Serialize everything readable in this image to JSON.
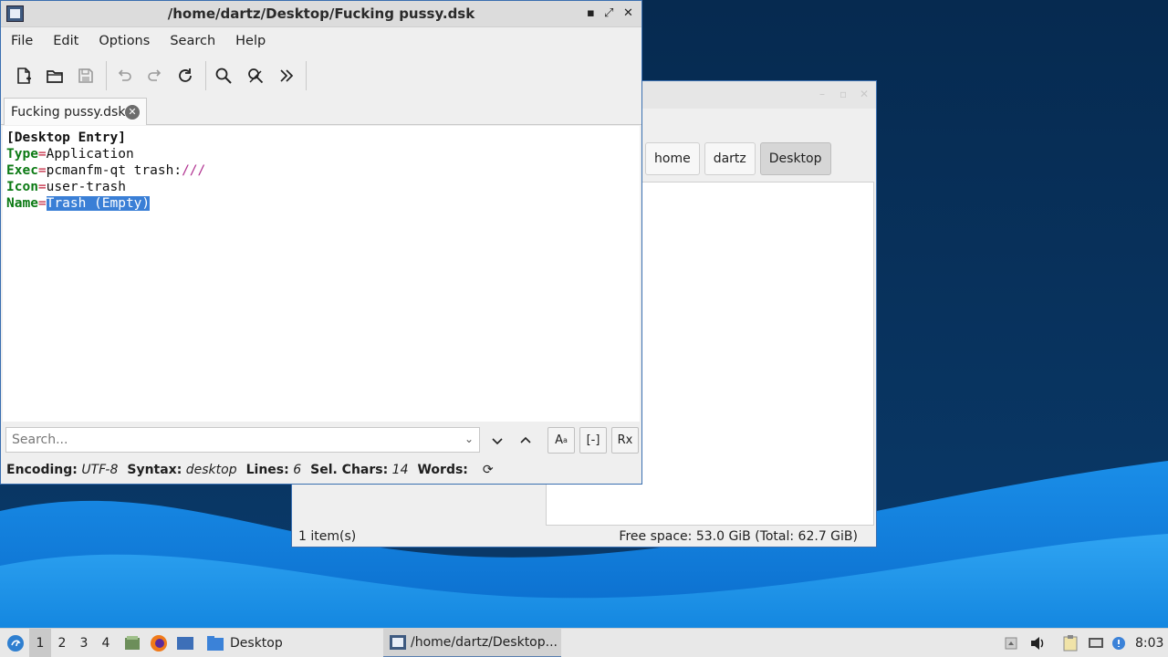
{
  "editor": {
    "title": "/home/dartz/Desktop/Fucking pussy.dsk",
    "menu": [
      "File",
      "Edit",
      "Options",
      "Search",
      "Help"
    ],
    "toolbar": [
      "new-file-icon",
      "open-folder-icon",
      "save-icon",
      "undo-icon",
      "redo-icon",
      "reload-icon",
      "find-icon",
      "replace-icon",
      "more-icon"
    ],
    "tab_label": "Fucking pussy.dsk",
    "lines": {
      "l1": "[Desktop Entry]",
      "l2_key": "Type",
      "l2_val": "Application",
      "l3_key": "Exec",
      "l3_val": "pcmanfm-qt trash:",
      "l3_url": "///",
      "l4_key": "Icon",
      "l4_val": "user-trash",
      "l5_key": "Name",
      "l5_val": "Trash (Empty)",
      "eq": "="
    },
    "search_placeholder": "Search...",
    "find_buttons": [
      "A",
      "[-]",
      "Rx"
    ],
    "status": {
      "encoding_label": "Encoding:",
      "encoding": "UTF-8",
      "syntax_label": "Syntax:",
      "syntax": "desktop",
      "lines_label": "Lines:",
      "lines": "6",
      "sel_label": "Sel. Chars:",
      "sel": "14",
      "words_label": "Words:"
    }
  },
  "file_manager": {
    "breadcrumbs": [
      "home",
      "dartz",
      "Desktop"
    ],
    "items_count": "1 item(s)",
    "free_space": "Free space: 53.0 GiB (Total: 62.7 GiB)"
  },
  "taskbar": {
    "desktops": [
      "1",
      "2",
      "3",
      "4"
    ],
    "desktop_task": "Desktop",
    "editor_task": "/home/dartz/Desktop...",
    "clock": "8:03"
  },
  "colors": {
    "selection": "#3a7fd6",
    "keyword": "#0c7a14",
    "equals": "#c0203a",
    "wallpaper": "#0b2f55"
  }
}
